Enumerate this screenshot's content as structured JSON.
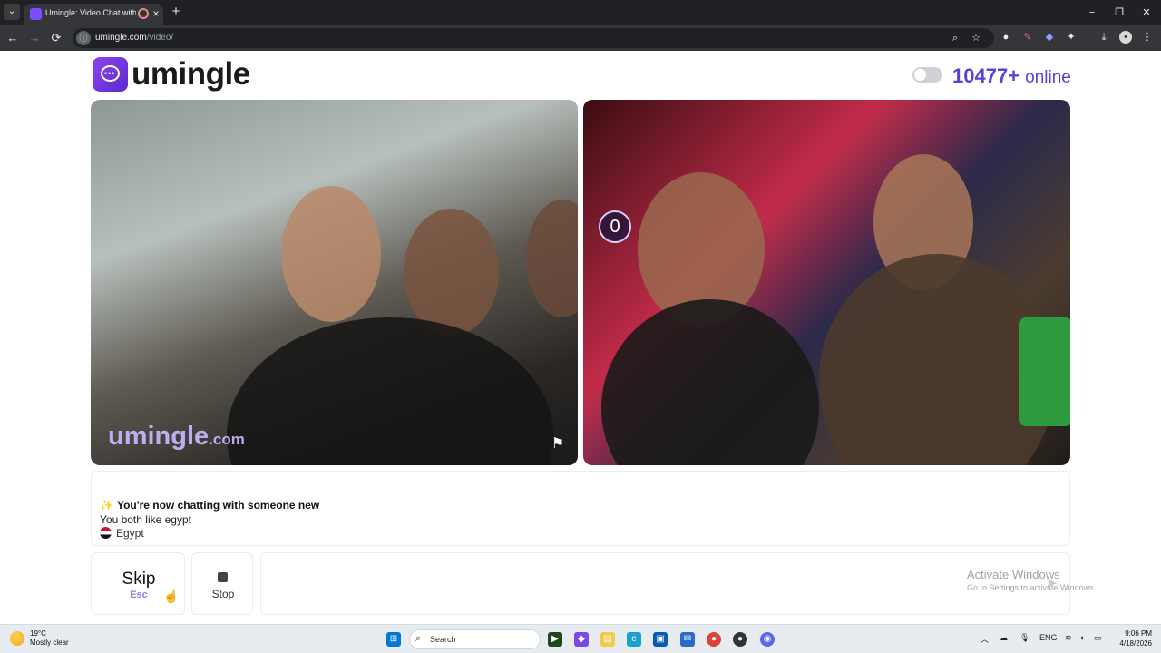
{
  "browser": {
    "tab_title": "Umingle: Video Chat with S",
    "tab_close": "×",
    "new_tab": "+",
    "window_controls": [
      "−",
      "❐",
      "✕"
    ],
    "url_domain": "umingle.com",
    "url_path": "/video/",
    "nav": {
      "back": "←",
      "forward": "→",
      "reload": "⟳"
    }
  },
  "header": {
    "logo_text": "umingle",
    "online_count": "10477+",
    "online_label": "online"
  },
  "videos": {
    "stranger_watermark_main": "umingle",
    "stranger_watermark_suffix": ".com",
    "self_counter": "0"
  },
  "chat": {
    "sparkle": "✨",
    "line1": "You're now chatting with someone new",
    "line2": "You both like egypt",
    "country": "Egypt"
  },
  "controls": {
    "skip_label": "Skip",
    "skip_key": "Esc",
    "stop_label": "Stop",
    "message_value": "",
    "send_icon": "➤"
  },
  "windows_activation": {
    "title": "Activate Windows",
    "subtitle": "Go to Settings to activate Windows."
  },
  "taskbar": {
    "weather_temp": "19°C",
    "weather_desc": "Mostly clear",
    "search_label": "Search",
    "lang": "ENG",
    "time": "9:06 PM",
    "date": "4/18/2026"
  }
}
